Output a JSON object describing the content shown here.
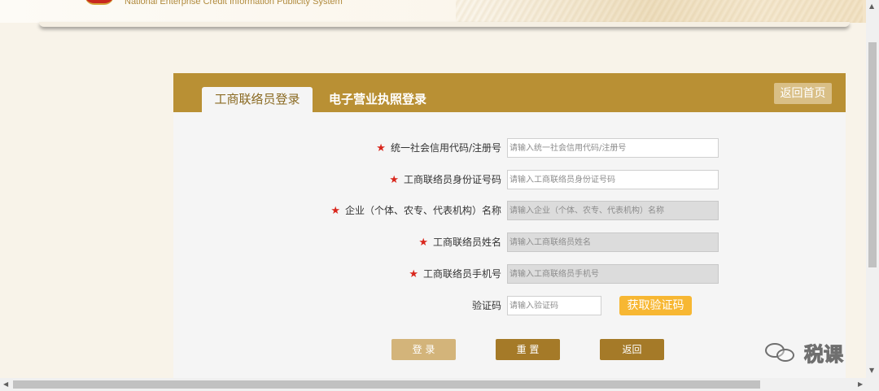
{
  "header": {
    "system_name_en": "National Enterprise Credit Information Publicity System"
  },
  "panel": {
    "tabs": [
      {
        "label": "工商联络员登录",
        "active": true
      },
      {
        "label": "电子营业执照登录",
        "active": false
      }
    ],
    "home_button": "返回首页"
  },
  "form": {
    "required_mark": "★",
    "fields": [
      {
        "label": "统一社会信用代码/注册号",
        "placeholder": "请输入统一社会信用代码/注册号",
        "value": "",
        "enabled": true,
        "required": true
      },
      {
        "label": "工商联络员身份证号码",
        "placeholder": "请输入工商联络员身份证号码",
        "value": "",
        "enabled": true,
        "required": true
      },
      {
        "label": "企业（个体、农专、代表机构）名称",
        "placeholder": "请输入企业（个体、农专、代表机构）名称",
        "value": "",
        "enabled": false,
        "required": true
      },
      {
        "label": "工商联络员姓名",
        "placeholder": "请输入工商联络员姓名",
        "value": "",
        "enabled": false,
        "required": true
      },
      {
        "label": "工商联络员手机号",
        "placeholder": "请输入工商联络员手机号",
        "value": "",
        "enabled": false,
        "required": true
      }
    ],
    "captcha": {
      "label": "验证码",
      "placeholder": "请输入验证码",
      "value": "",
      "button": "获取验证码"
    },
    "buttons": {
      "login": "登 录",
      "reset": "重 置",
      "back": "返回"
    }
  },
  "watermark": {
    "text": "税课"
  },
  "colors": {
    "header_bar": "#b99034",
    "accent_orange": "#f7b733",
    "button_dark": "#a57a28",
    "button_light": "#d3b47a",
    "required_star": "#d9261c"
  }
}
